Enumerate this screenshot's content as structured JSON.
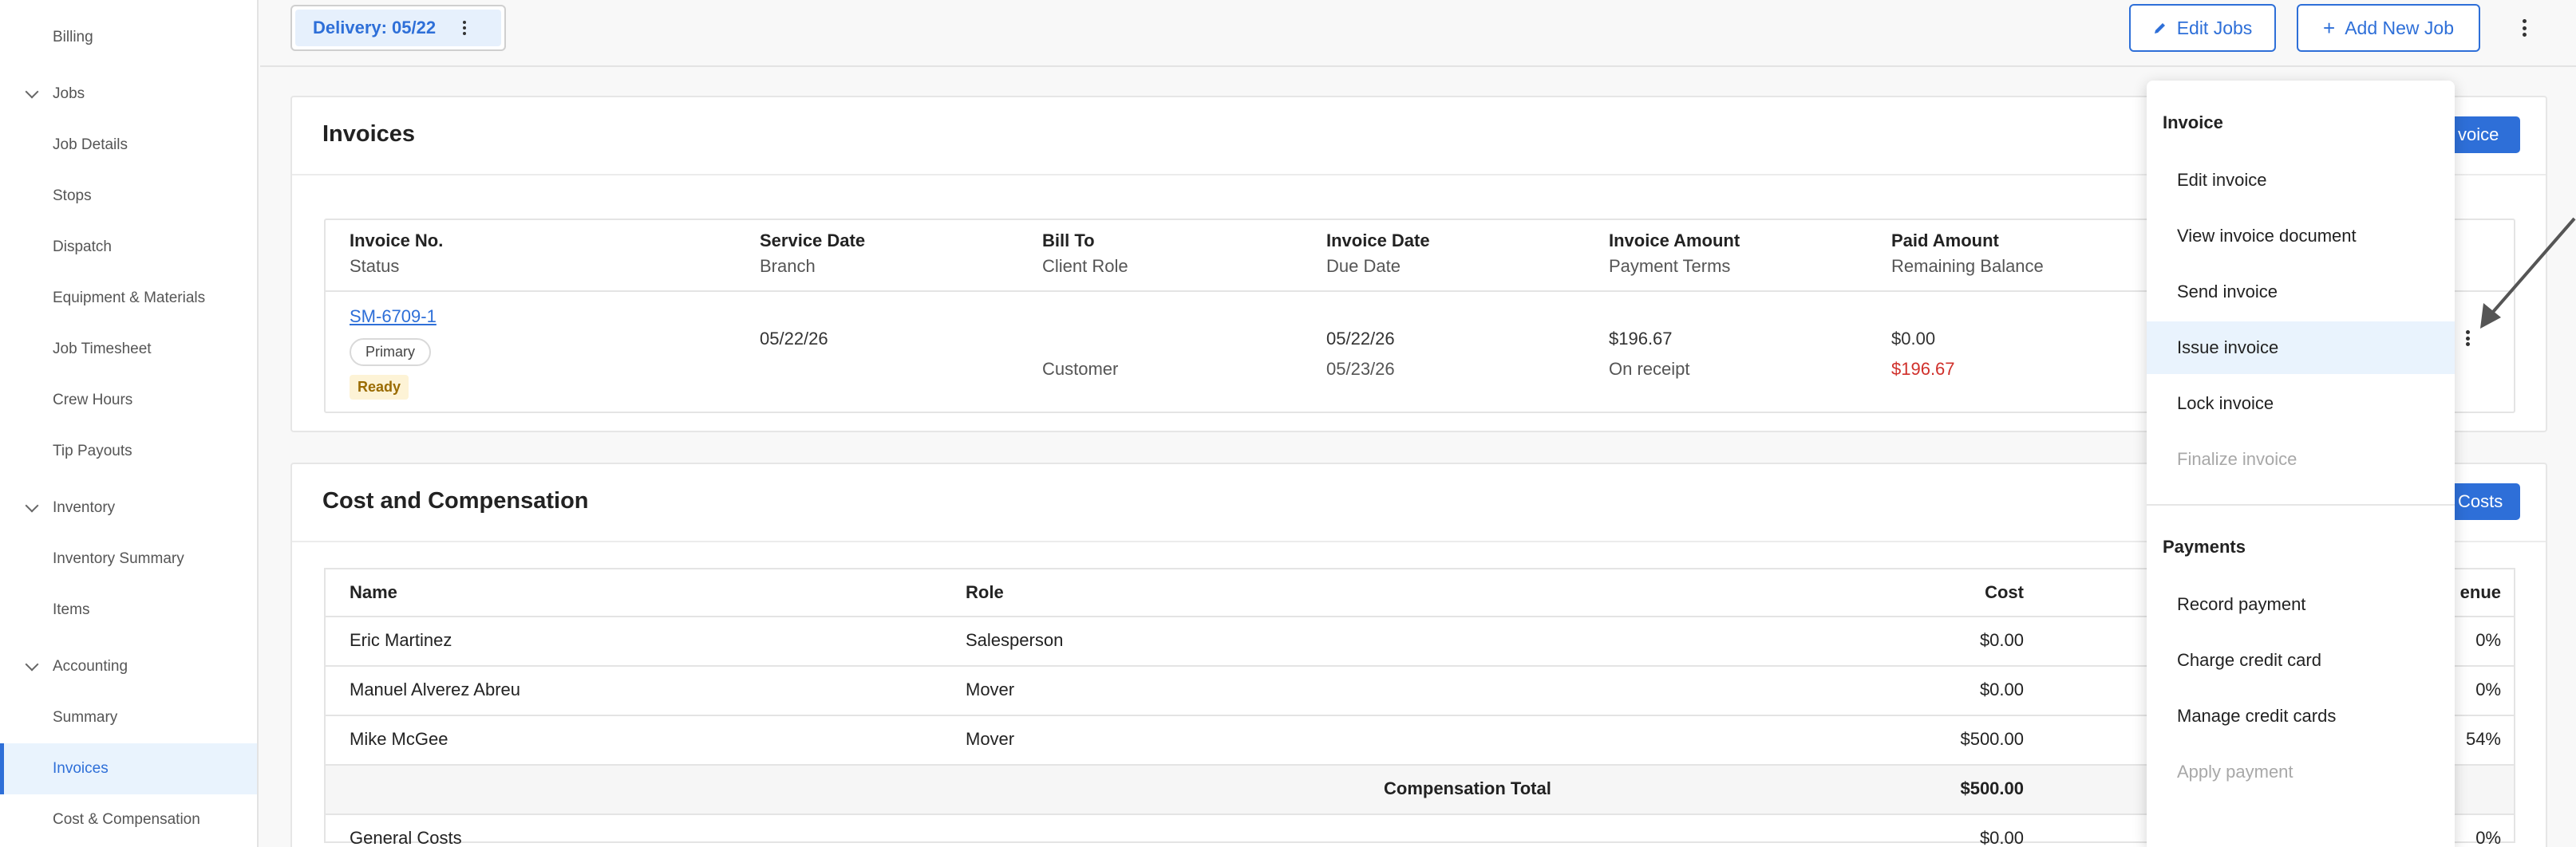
{
  "sidebar": {
    "items": [
      {
        "label": "Billing"
      },
      {
        "label": "Jobs",
        "group": true
      },
      {
        "label": "Job Details"
      },
      {
        "label": "Stops"
      },
      {
        "label": "Dispatch"
      },
      {
        "label": "Equipment & Materials"
      },
      {
        "label": "Job Timesheet"
      },
      {
        "label": "Crew Hours"
      },
      {
        "label": "Tip Payouts"
      },
      {
        "label": "Inventory",
        "group": true
      },
      {
        "label": "Inventory Summary"
      },
      {
        "label": "Items"
      },
      {
        "label": "Accounting",
        "group": true
      },
      {
        "label": "Summary"
      },
      {
        "label": "Invoices",
        "active": true
      },
      {
        "label": "Cost & Compensation"
      }
    ]
  },
  "topbar": {
    "delivery_label": "Delivery: 05/22",
    "edit_jobs": "Edit Jobs",
    "add_new_job": "Add New Job"
  },
  "invoices": {
    "title": "Invoices",
    "button_partial": "voice",
    "headers": [
      {
        "l1": "Invoice No.",
        "l2": "Status"
      },
      {
        "l1": "Service Date",
        "l2": "Branch"
      },
      {
        "l1": "Bill To",
        "l2": "Client Role"
      },
      {
        "l1": "Invoice Date",
        "l2": "Due Date"
      },
      {
        "l1": "Invoice Amount",
        "l2": "Payment Terms"
      },
      {
        "l1": "Paid Amount",
        "l2": "Remaining Balance"
      }
    ],
    "row": {
      "invoice_no": "SM-6709-1",
      "badge_primary": "Primary",
      "status": "Ready",
      "service_date": "05/22/26",
      "client_role": "Customer",
      "invoice_date": "05/22/26",
      "due_date": "05/23/26",
      "invoice_amount": "$196.67",
      "payment_terms": "On receipt",
      "paid_amount": "$0.00",
      "remaining_balance": "$196.67"
    }
  },
  "costs": {
    "title": "Cost and Compensation",
    "button_partial": "Costs",
    "headers": {
      "name": "Name",
      "role": "Role",
      "cost": "Cost",
      "revenue_partial": "enue"
    },
    "rows": [
      {
        "name": "Eric Martinez",
        "role": "Salesperson",
        "cost": "$0.00",
        "pct": "0%"
      },
      {
        "name": "Manuel Alverez Abreu",
        "role": "Mover",
        "cost": "$0.00",
        "pct": "0%"
      },
      {
        "name": "Mike McGee",
        "role": "Mover",
        "cost": "$500.00",
        "pct": "54%"
      }
    ],
    "total_label": "Compensation Total",
    "total_value": "$500.00",
    "general_costs": {
      "name": "General Costs",
      "cost": "$0.00",
      "pct": "0%"
    }
  },
  "menu": {
    "section_invoice": "Invoice",
    "invoice_items": [
      {
        "label": "Edit invoice"
      },
      {
        "label": "View invoice document"
      },
      {
        "label": "Send invoice"
      },
      {
        "label": "Issue invoice",
        "active": true
      },
      {
        "label": "Lock invoice"
      },
      {
        "label": "Finalize invoice",
        "disabled": true
      }
    ],
    "section_payments": "Payments",
    "payment_items": [
      {
        "label": "Record payment"
      },
      {
        "label": "Charge credit card"
      },
      {
        "label": "Manage credit cards"
      },
      {
        "label": "Apply payment",
        "disabled": true
      }
    ]
  }
}
